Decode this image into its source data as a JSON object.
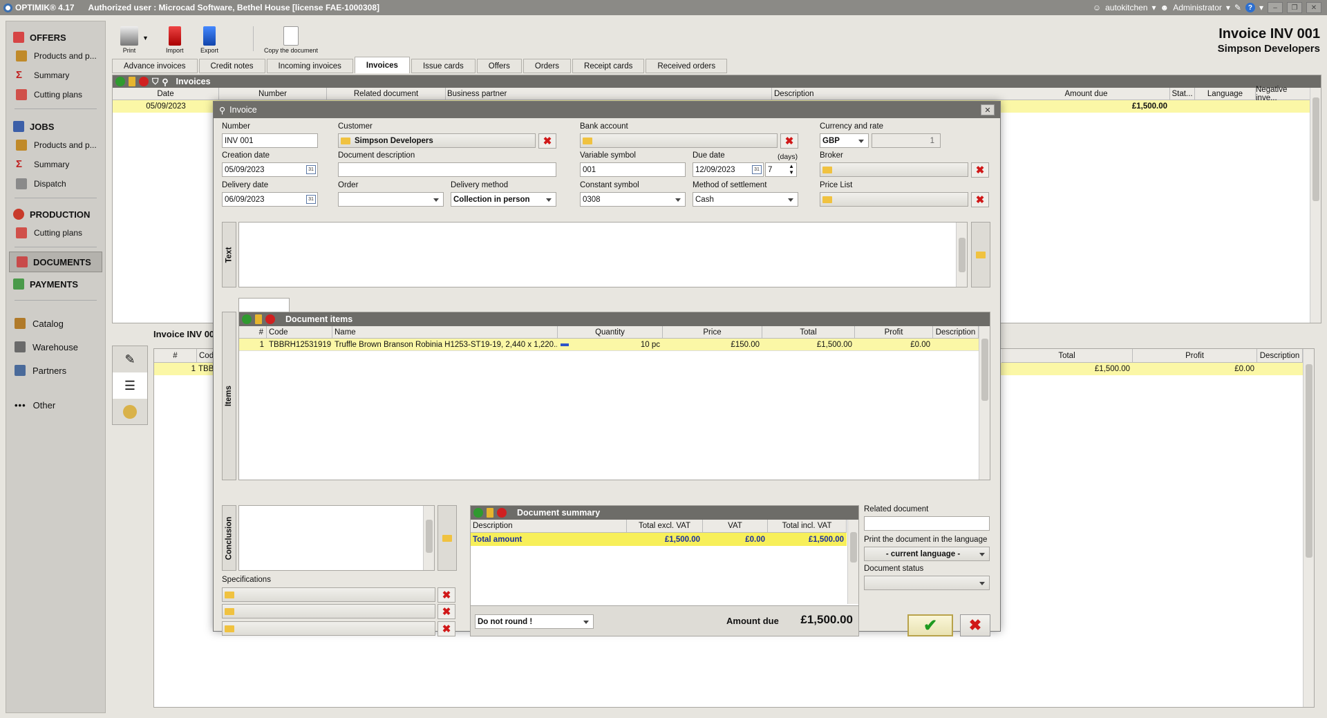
{
  "titlebar": {
    "app": "OPTIMIK® 4.17",
    "authorized": "Authorized user :  Microcad Software, Bethel House  [license FAE-1000308]",
    "user1": "autokitchen",
    "user2": "Administrator"
  },
  "sidebar": {
    "offers": "OFFERS",
    "offers_products": "Products and p...",
    "offers_summary": "Summary",
    "offers_cutting": "Cutting plans",
    "jobs": "JOBS",
    "jobs_products": "Products and p...",
    "jobs_summary": "Summary",
    "jobs_dispatch": "Dispatch",
    "production": "PRODUCTION",
    "production_cutting": "Cutting plans",
    "documents": "DOCUMENTS",
    "payments": "PAYMENTS",
    "catalog": "Catalog",
    "warehouse": "Warehouse",
    "partners": "Partners",
    "other": "Other"
  },
  "toolbar": {
    "print": "Print",
    "import": "Import",
    "export": "Export",
    "copy": "Copy the document"
  },
  "tabs": [
    "Advance invoices",
    "Credit notes",
    "Incoming invoices",
    "Invoices",
    "Issue cards",
    "Offers",
    "Orders",
    "Receipt cards",
    "Received orders"
  ],
  "header": {
    "title": "Invoice INV 001",
    "subtitle": "Simpson Developers"
  },
  "invoices_grid": {
    "bar": "Invoices",
    "cols": {
      "date": "Date",
      "number": "Number",
      "related": "Related document",
      "partner": "Business partner",
      "description": "Description",
      "amount_due": "Amount due",
      "status": "Stat...",
      "language": "Language",
      "negative": "Negative inve..."
    },
    "row": {
      "date": "05/09/2023",
      "amount_due": "£1,500.00"
    }
  },
  "detail": {
    "label": "Invoice INV 00",
    "cols": {
      "num": "#",
      "code": "Cod",
      "total": "Total",
      "profit": "Profit",
      "description": "Description"
    },
    "row": {
      "num": "1",
      "code": "TBB",
      "total": "£1,500.00",
      "profit": "£0.00"
    }
  },
  "modal": {
    "title": "Invoice",
    "number_label": "Number",
    "number": "INV 001",
    "creation_label": "Creation date",
    "creation": "05/09/2023",
    "delivery_label": "Delivery date",
    "delivery": "06/09/2023",
    "customer_label": "Customer",
    "customer": "Simpson Developers",
    "docdesc_label": "Document description",
    "order_label": "Order",
    "method_label": "Delivery method",
    "method": "Collection in person",
    "bank_label": "Bank account",
    "varsym_label": "Variable symbol",
    "varsym": "001",
    "due_label": "Due date",
    "due": "12/09/2023",
    "days_label": "(days)",
    "days": "7",
    "constsym_label": "Constant symbol",
    "constsym": "0308",
    "settle_label": "Method of settlement",
    "settle": "Cash",
    "currency_label": "Currency and rate",
    "currency": "GBP",
    "rate": "1",
    "broker_label": "Broker",
    "pricelist_label": "Price List",
    "text_tab": "Text",
    "items_tab": "Items",
    "conclusion_tab": "Conclusion",
    "items_bar": "Document items",
    "items_cols": {
      "num": "#",
      "code": "Code",
      "name": "Name",
      "qty": "Quantity",
      "price": "Price",
      "total": "Total",
      "profit": "Profit",
      "desc": "Description"
    },
    "item": {
      "num": "1",
      "code": "TBBRH12531919",
      "name": "Truffle Brown Branson Robinia H1253-ST19-19, 2,440 x 1,220...",
      "qty": "10 pc",
      "price": "£150.00",
      "total": "£1,500.00",
      "profit": "£0.00"
    },
    "specs_label": "Specifications",
    "summary_bar": "Document summary",
    "summary_cols": {
      "desc": "Description",
      "excl": "Total excl. VAT",
      "vat": "VAT",
      "incl": "Total incl. VAT"
    },
    "summary_row": {
      "desc": "Total amount",
      "excl": "£1,500.00",
      "vat": "£0.00",
      "incl": "£1,500.00"
    },
    "rounding": "Do not round !",
    "amount_due_label": "Amount due",
    "amount_due": "£1,500.00",
    "related_label": "Related document",
    "print_lang_label": "Print the document in the language",
    "print_lang": "- current language -",
    "status_label": "Document status"
  }
}
